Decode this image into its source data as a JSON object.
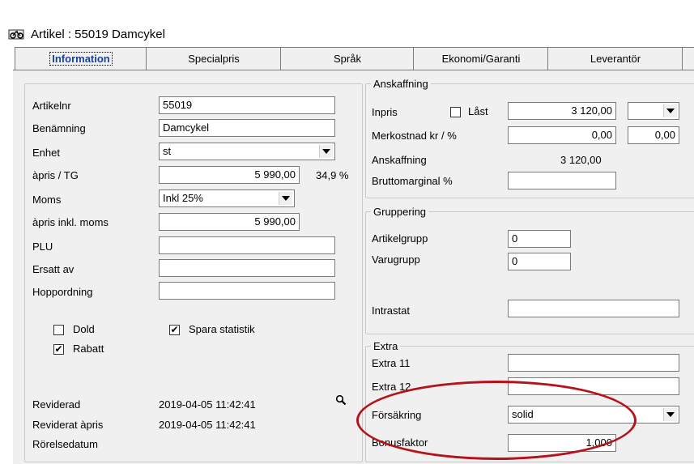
{
  "window": {
    "title": "Artikel : 55019 Damcykel"
  },
  "tabs": [
    "Information",
    "Specialpris",
    "Språk",
    "Ekonomi/Garanti",
    "Leverantör"
  ],
  "left": {
    "artikelnr_label": "Artikelnr",
    "artikelnr": "55019",
    "benamning_label": "Benämning",
    "benamning": "Damcykel",
    "enhet_label": "Enhet",
    "enhet": "st",
    "apris_label": "àpris / TG",
    "apris": "5 990,00",
    "tg": "34,9 %",
    "moms_label": "Moms",
    "moms": "Inkl 25%",
    "apris_moms_label": "àpris inkl. moms",
    "apris_moms": "5 990,00",
    "plu_label": "PLU",
    "plu": "",
    "ersatt_label": "Ersatt av",
    "ersatt": "",
    "hopp_label": "Hoppordning",
    "hopp": "",
    "dold_label": "Dold",
    "dold_checked": false,
    "spara_label": "Spara statistik",
    "spara_checked": true,
    "rabatt_label": "Rabatt",
    "rabatt_checked": true,
    "reviderad_label": "Reviderad",
    "reviderad": "2019-04-05 11:42:41",
    "reviderat_apris_label": "Reviderat àpris",
    "reviderat_apris": "2019-04-05 11:42:41",
    "rorelse_label": "Rörelsedatum"
  },
  "anskaffning": {
    "title": "Anskaffning",
    "inpris_label": "Inpris",
    "last_label": "Låst",
    "last_checked": false,
    "inpris": "3 120,00",
    "inpris_unit": "",
    "merkostnad_label": "Merkostnad kr / %",
    "merkostnad_kr": "0,00",
    "merkostnad_pct": "0,00",
    "anskaffning_label": "Anskaffning",
    "anskaffning": "3 120,00",
    "brutto_label": "Bruttomarginal %",
    "brutto": ""
  },
  "gruppering": {
    "title": "Gruppering",
    "artikelgrupp_label": "Artikelgrupp",
    "artikelgrupp": "0",
    "varugrupp_label": "Varugrupp",
    "varugrupp": "0",
    "intrastat_label": "Intrastat",
    "intrastat": ""
  },
  "extra": {
    "title": "Extra",
    "extra11_label": "Extra 11",
    "extra11": "",
    "extra12_label": "Extra 12",
    "extra12": "",
    "forsakring_label": "Försäkring",
    "forsakring": "solid",
    "bonus_label": "Bonusfaktor",
    "bonus": "1,000"
  }
}
